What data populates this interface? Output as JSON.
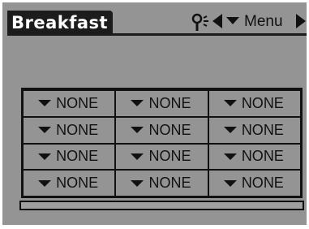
{
  "app": {
    "title": "Breakfast",
    "menu_label": "Menu"
  },
  "icons": {
    "signal": "signal-antenna-icon",
    "nav_left": "arrow-left-icon",
    "nav_right": "arrow-right-icon",
    "dropdown": "dropdown-triangle-icon"
  },
  "colors": {
    "screen_bg": "#949494",
    "ink": "#111111",
    "title_text": "#ffffff"
  },
  "grid": {
    "rows": [
      [
        "NONE",
        "NONE",
        "NONE"
      ],
      [
        "NONE",
        "NONE",
        "NONE"
      ],
      [
        "NONE",
        "NONE",
        "NONE"
      ],
      [
        "NONE",
        "NONE",
        "NONE"
      ]
    ]
  }
}
